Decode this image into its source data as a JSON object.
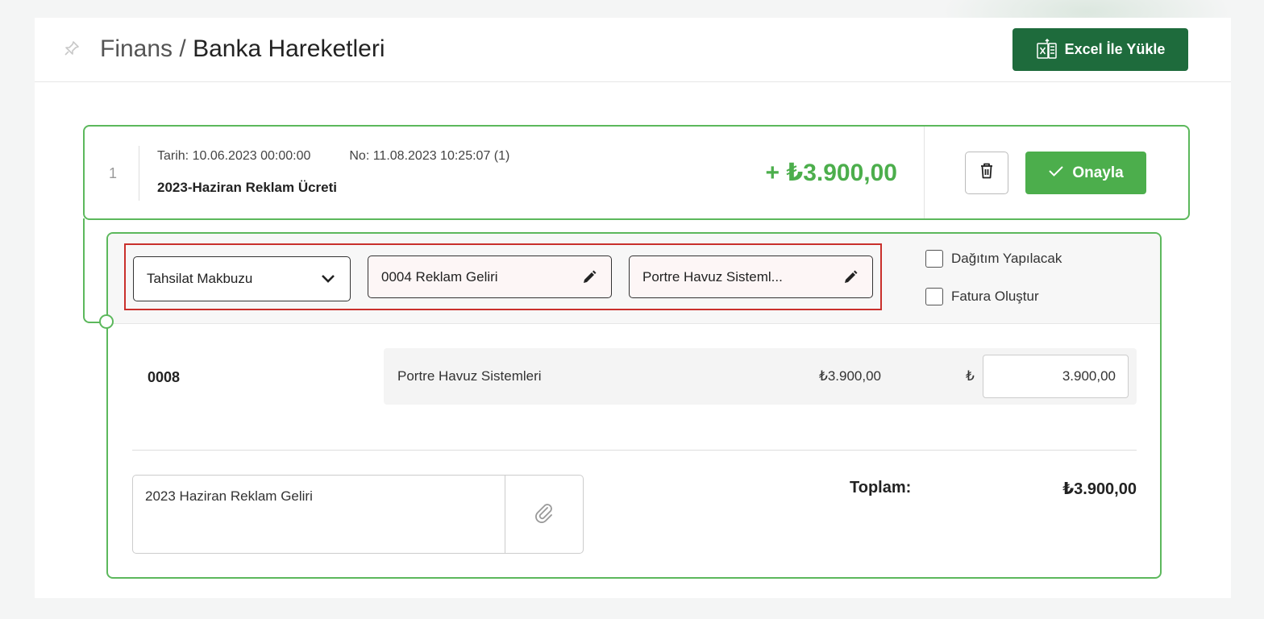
{
  "header": {
    "breadcrumb_parent": "Finans",
    "breadcrumb_separator": " / ",
    "breadcrumb_current": "Banka Hareketleri",
    "excel_button_label": "Excel İle Yükle"
  },
  "transaction": {
    "index": "1",
    "date": "Tarih: 10.06.2023 00:00:00",
    "number": "No: 11.08.2023 10:25:07 (1)",
    "description": "2023-Haziran Reklam Ücreti",
    "amount": "+ ₺3.900,00",
    "approve_label": "Onayla"
  },
  "detail": {
    "document_type": "Tahsilat Makbuzu",
    "account": "0004 Reklam Geliri",
    "customer": "Portre Havuz Sisteml...",
    "checkbox_distribution": "Dağıtım Yapılacak",
    "checkbox_invoice": "Fatura Oluştur",
    "line": {
      "code": "0008",
      "name": "Portre Havuz Sistemleri",
      "amount": "₺3.900,00",
      "currency": "₺",
      "input_value": "3.900,00"
    },
    "note": "2023 Haziran Reklam Geliri",
    "total_label": "Toplam:",
    "total_value": "₺3.900,00"
  },
  "colors": {
    "brand_dark_green": "#1e6b3c",
    "accent_green": "#4cae4c",
    "border_green": "#5cb85c",
    "error_red": "#c9302c"
  },
  "icons": {
    "pin": "pin-icon",
    "excel": "excel-upload-icon",
    "trash": "trash-icon",
    "check": "check-icon",
    "chevron": "chevron-down-icon",
    "pencil": "pencil-icon",
    "paperclip": "paperclip-icon"
  }
}
